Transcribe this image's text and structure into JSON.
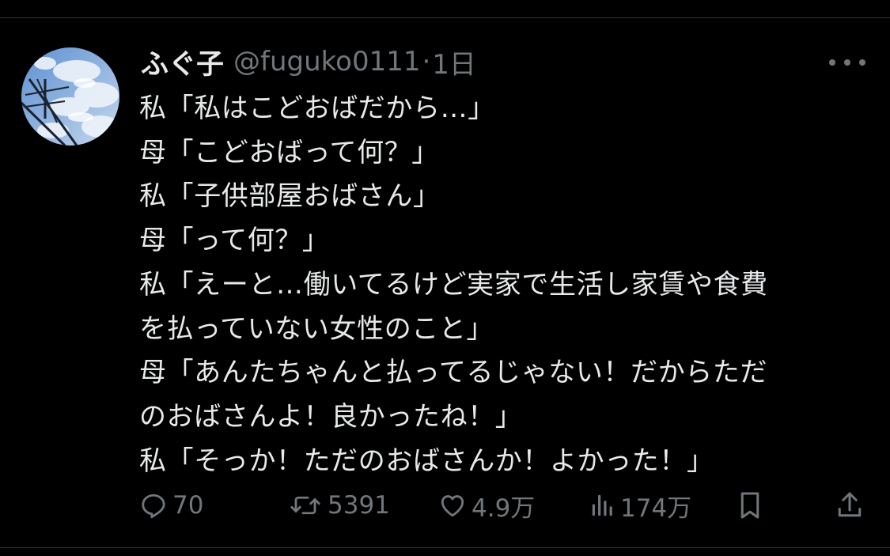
{
  "tweet": {
    "display_name": "ふぐ子",
    "handle": "@fuguko0111",
    "separator": "·",
    "time": "1日",
    "lines": [
      "私「私はこどおばだから…」",
      "母「こどおばって何？」",
      "私「子供部屋おばさん」",
      "母「って何？」",
      "私「えーと…働いてるけど実家で生活し家賃や食費",
      "を払っていない女性のこと」",
      "母「あんたちゃんと払ってるじゃない！だからただ",
      "のおばさんよ！良かったね！」",
      "私「そっか！ただのおばさんか！よかった！」"
    ]
  },
  "actions": {
    "replies": "70",
    "retweets": "5391",
    "likes": "4.9万",
    "views": "174万"
  },
  "icons": {
    "avatar": "sky-photo-avatar",
    "more": "more-horizontal-icon",
    "reply": "reply-icon",
    "retweet": "retweet-icon",
    "like": "heart-icon",
    "views": "views-chart-icon",
    "bookmark": "bookmark-icon",
    "share": "share-icon"
  },
  "colors": {
    "background": "#000000",
    "text": "#e7e9ea",
    "muted": "#71767b",
    "divider": "#2f3336"
  }
}
